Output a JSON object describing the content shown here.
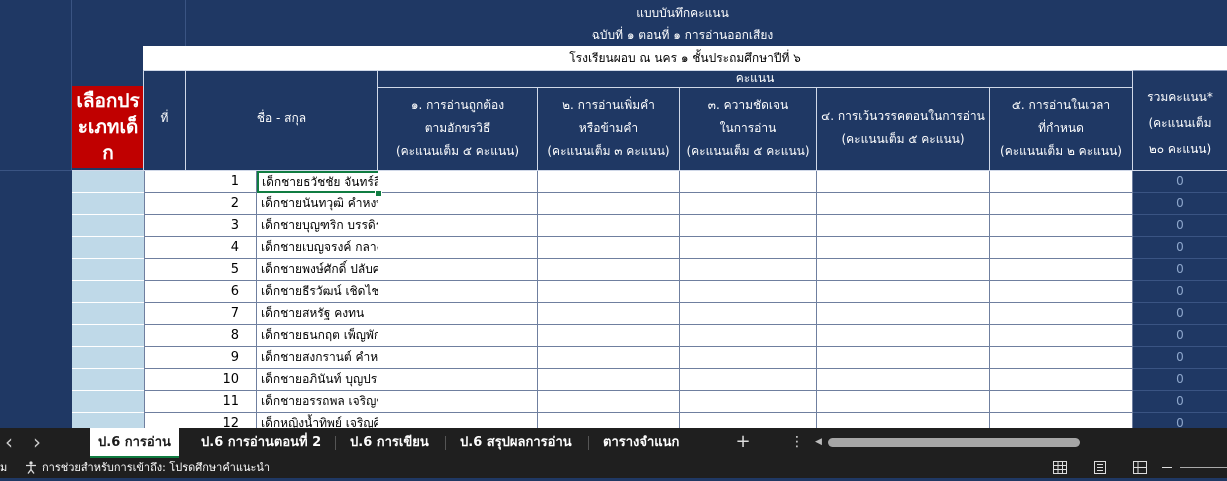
{
  "sheet": {
    "title_line1": "แบบบันทึกคะแนน",
    "title_line2": "ฉบับที่ ๑ ตอนที่ ๑ การอ่านออกเสียง",
    "school_line": "โรงเรียนผอบ ณ นคร ๑  ชั้นประถมศึกษาปีที่ ๖",
    "select_type_label": "เลือกประเภทเด็ก",
    "col_no": "ที่",
    "col_name": "ชื่อ -  สกุล",
    "score_group": "คะแนน",
    "score_cols": [
      {
        "line1": "๑. การอ่านถูกต้อง",
        "line2": "ตามอักขรวิธี",
        "line3": "(คะแนนเต็ม ๕ คะแนน)"
      },
      {
        "line1": "๒. การอ่านเพิ่มคำ",
        "line2": "หรือข้ามคำ",
        "line3": "(คะแนนเต็ม ๓ คะแนน)"
      },
      {
        "line1": "๓. ความชัดเจน",
        "line2": "ในการอ่าน",
        "line3": "(คะแนนเต็ม ๕ คะแนน)"
      },
      {
        "line1": "๔. การเว้นวรรคตอนในการอ่าน",
        "line2": "(คะแนนเต็ม ๕ คะแนน)",
        "line3": ""
      },
      {
        "line1": "๕. การอ่านในเวลา",
        "line2": "ที่กำหนด",
        "line3": "(คะแนนเต็ม ๒ คะแนน)"
      }
    ],
    "total_col": {
      "line1": "รวมคะแนน*",
      "line2": "(คะแนนเต็ม",
      "line3": "๒๐ คะแนน)"
    },
    "rows": [
      {
        "no": "1",
        "name": "เด็กชายธวัชชัย   จันทร์สืบ",
        "total": "0"
      },
      {
        "no": "2",
        "name": "เด็กชายนันทวุฒิ     คำหงษา",
        "total": "0"
      },
      {
        "no": "3",
        "name": "เด็กชายบุญฑริก    บรรดิราช",
        "total": "0"
      },
      {
        "no": "4",
        "name": "เด็กชายเบญจรงค์   กลางเมือง",
        "total": "0"
      },
      {
        "no": "5",
        "name": "เด็กชายพงษ์ศักดิ์   ปลับศรี",
        "total": "0"
      },
      {
        "no": "6",
        "name": "เด็กชายธีรวัฒน์   เชิดไชย",
        "total": "0"
      },
      {
        "no": "7",
        "name": "เด็กชายสหรัฐ   คงทน",
        "total": "0"
      },
      {
        "no": "8",
        "name": "เด็กชายธนกฤต   เพ็ญพักตร์",
        "total": "0"
      },
      {
        "no": "9",
        "name": "เด็กชายสงกรานต์   คำหงษา",
        "total": "0"
      },
      {
        "no": "10",
        "name": "เด็กชายอภินันท์    บุญประกอบ",
        "total": "0"
      },
      {
        "no": "11",
        "name": "เด็กชายอรรถพล      เจริญชาติ",
        "total": "0"
      },
      {
        "no": "12",
        "name": "เด็กหญิงน้ำทิพย์    เจริญศิลป์",
        "total": "0"
      }
    ]
  },
  "tabs": [
    "ป.6 การอ่าน",
    "ป.6 การอ่านตอนที่ 2",
    "ป.6 การเขียน",
    "ป.6 สรุปผลการอ่าน",
    "ตารางจำแนก"
  ],
  "active_tab_index": 0,
  "tabbar": {
    "prev": "‹",
    "next": "›",
    "add": "+",
    "more": "⋮",
    "scroll_left": "◀"
  },
  "statusbar": {
    "left_fragment": "ม",
    "accessibility": "การช่วยสำหรับการเข้าถึง: โปรดศึกษาคำแนะนำ"
  },
  "colors": {
    "sheet_bg": "#1f3864",
    "select_red": "#c00000",
    "light_col": "#bfd9e8",
    "active_tab_line": "#107c41"
  }
}
